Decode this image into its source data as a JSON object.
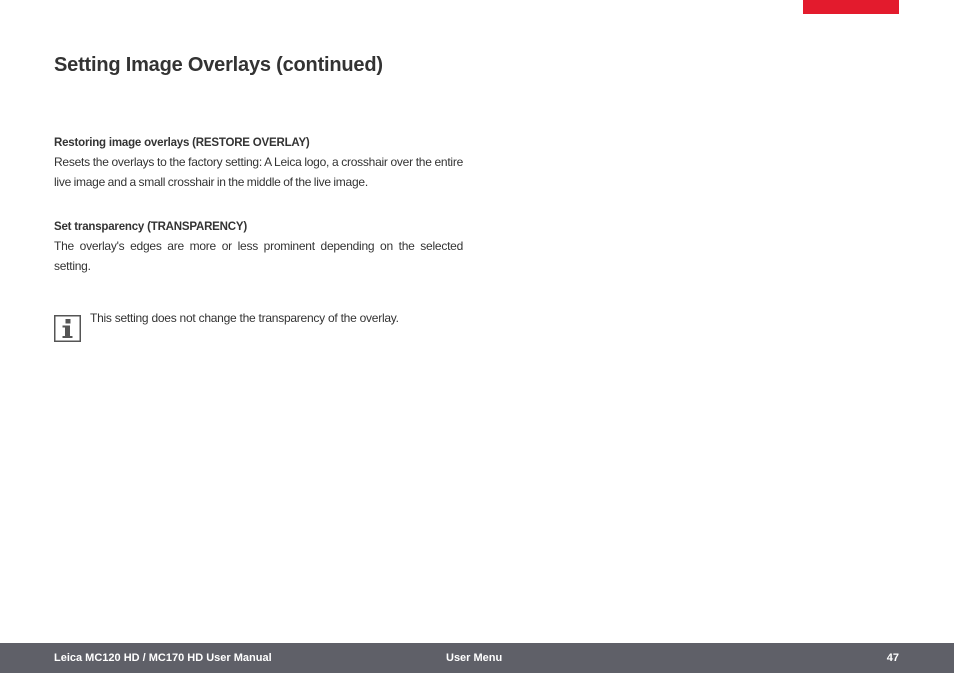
{
  "colors": {
    "accent": "#e31b2d",
    "footer_bg": "#5f6068",
    "text": "#333333",
    "icon": "#555555"
  },
  "page": {
    "title": "Setting Image Overlays (continued)"
  },
  "sections": [
    {
      "heading": "Restoring image overlays (RESTORE OVERLAY)",
      "body": "Resets the overlays to the factory setting: A Leica logo, a crosshair over the entire live image and a small crosshair in the middle of the live image."
    },
    {
      "heading": "Set transparency (TRANSPARENCY)",
      "body": "The overlay's edges are more or less prominent depending on the selected setting."
    }
  ],
  "note": {
    "icon": "info-icon",
    "text": "This setting does not change the transparency of the overlay."
  },
  "footer": {
    "manual_title": "Leica MC120 HD / MC170 HD User Manual",
    "chapter": "User Menu",
    "page_number": "47"
  }
}
